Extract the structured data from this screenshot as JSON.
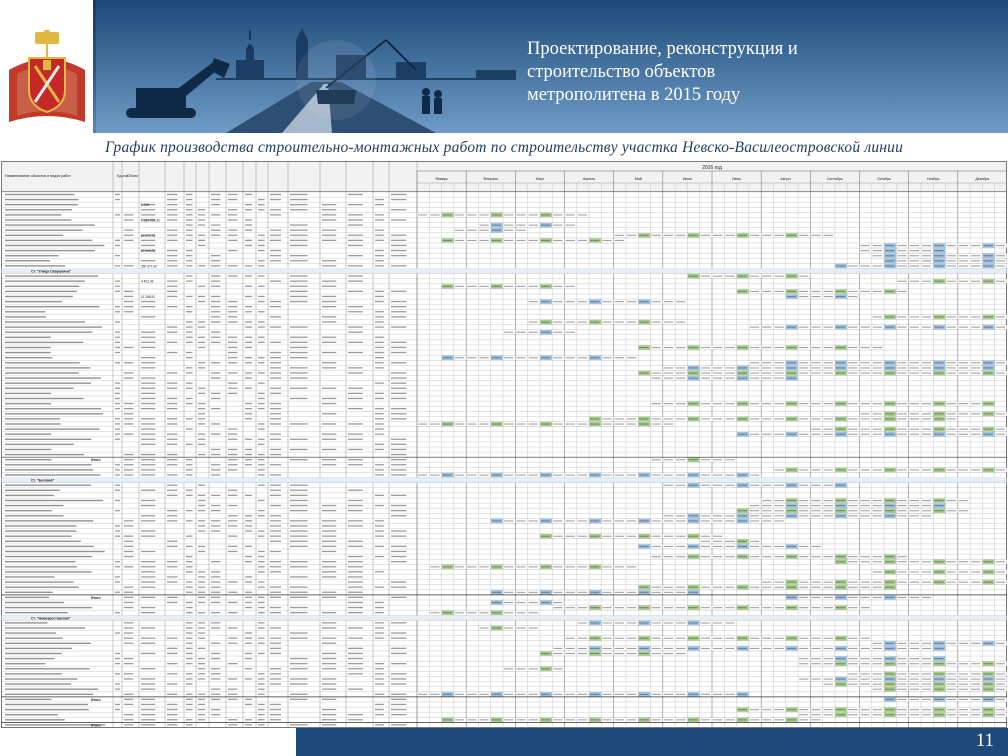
{
  "header": {
    "title_lines": [
      "Проектирование, реконструкция и",
      "строительство  объектов",
      "метрополитена в 2015 году"
    ]
  },
  "subtitle": "График производства строительно-монтажных работ по строительству участка Невско-Василеостровской линии",
  "schedule": {
    "year_caption": "2016 год",
    "columns": {
      "name": "Наименование объектов и видов работ",
      "unit": "Ед.изм.",
      "volume": "Объем"
    },
    "months": [
      "Январь",
      "Февраль",
      "Март",
      "Апрель",
      "Май",
      "Июнь",
      "Июль",
      "Август",
      "Сентябрь",
      "Октябрь",
      "Ноябрь",
      "Декабрь"
    ],
    "sections": [
      {
        "label": "Ст. \"Улица Савушкина\"",
        "row": 15
      },
      {
        "label": "Ст. \"Беговая\"",
        "row": 56
      },
      {
        "label": "Ст. \"Новокрестовская\"",
        "row": 83
      }
    ],
    "totals": [
      "Итого",
      "Итого",
      "Итого",
      "Итого"
    ],
    "sample_numbers": [
      "2 208",
      "1 330 025,30",
      "64 672,76",
      "67 040,00",
      "350 677,00",
      "4 402,36",
      "11 268,91"
    ]
  },
  "colors": {
    "header_dark": "#173a63",
    "cell_green": "#a9d18e",
    "cell_blue": "#9cc3e5",
    "footer": "#1e4a79"
  },
  "footer": {
    "page_number": "11"
  }
}
